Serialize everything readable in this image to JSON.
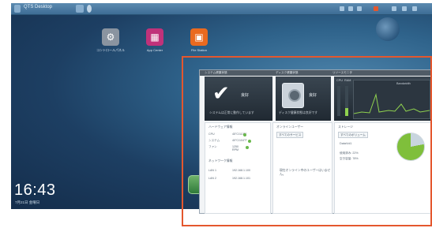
{
  "taskbar": {
    "menu_text": "QTS Desktop",
    "colors": {
      "alert": "#e4572e"
    }
  },
  "desktop": {
    "icons": [
      {
        "name": "control-panel-icon",
        "label": "コントロールパネル",
        "glyph": "⚙",
        "color": "#8a94a0"
      },
      {
        "name": "app-center-icon",
        "label": "App Center",
        "glyph": "▦",
        "color": "#c0327a"
      },
      {
        "name": "file-station-icon",
        "label": "File Station",
        "glyph": "▣",
        "color": "#ea6a1f"
      }
    ],
    "clock_time": "16:43",
    "clock_date": "7月21日 金曜日"
  },
  "widget": {
    "tabs": [
      "システム健康状態",
      "ディスク健康状態",
      "リソースモニタ"
    ],
    "system_health": {
      "status": "良好",
      "caption": "システムは正常に動作しています"
    },
    "disk_health": {
      "status": "良好",
      "caption": "ディスク健康状態は良好です"
    },
    "resource": {
      "labels": [
        "CPU",
        "RAM"
      ],
      "caption": "Bandwidth"
    },
    "hardware_panel": {
      "title": "ハードウェア情報",
      "rows": [
        {
          "label": "CPU",
          "value": "45°C/113°F"
        },
        {
          "label": "システム",
          "value": "40°C/104°F"
        },
        {
          "label": "ファン",
          "value": "1250 RPM"
        }
      ],
      "network_title": "ネットワーク情報",
      "network": [
        {
          "label": "LAN 1",
          "value": "192.168.1.100"
        },
        {
          "label": "LAN 2",
          "value": "192.168.1.101"
        }
      ]
    },
    "online_panel": {
      "title": "オンラインユーザー",
      "dropdown": "すべてのサービス",
      "empty_text": "現在オンライン中のユーザーはいません。"
    },
    "storage_panel": {
      "title": "ストレージ",
      "dropdown": "すべてのボリューム",
      "volume": "DataVol1",
      "legend": [
        "使用済み: 22%",
        "空き容量: 78%"
      ],
      "used_fraction": 0.22
    }
  }
}
